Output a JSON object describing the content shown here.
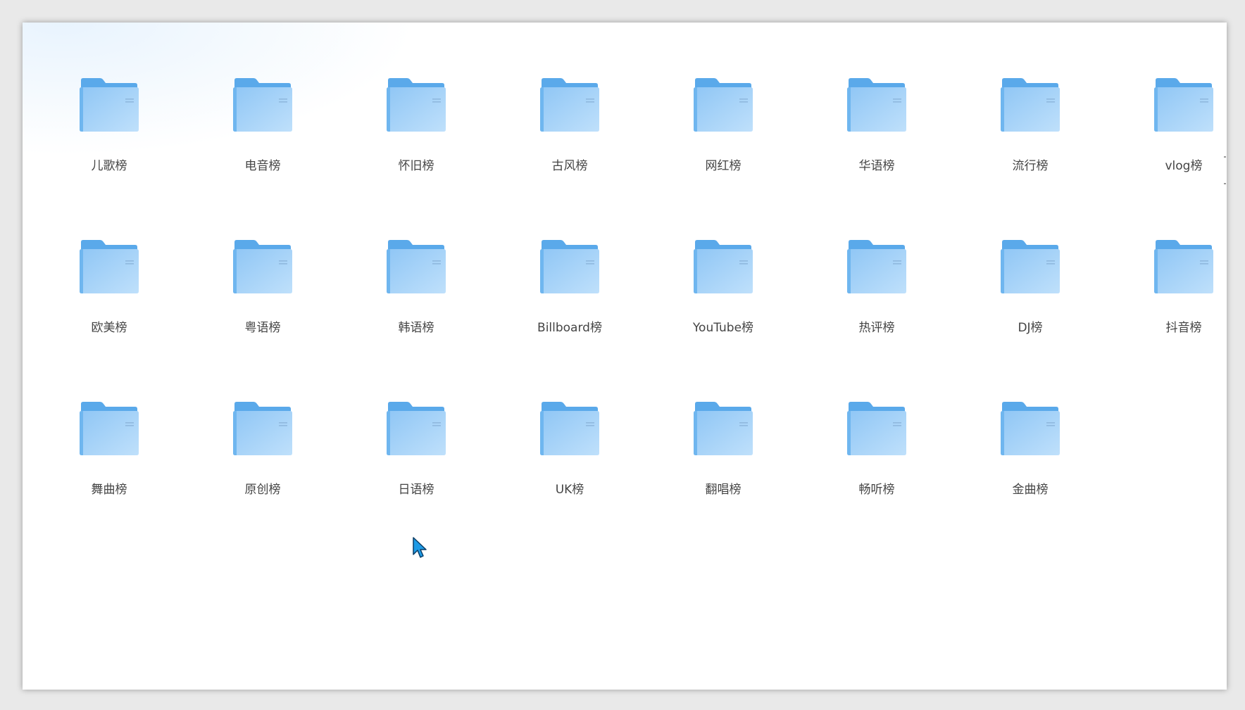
{
  "folders": [
    {
      "name": "儿歌榜"
    },
    {
      "name": "电音榜"
    },
    {
      "name": "怀旧榜"
    },
    {
      "name": "古风榜"
    },
    {
      "name": "网红榜"
    },
    {
      "name": "华语榜"
    },
    {
      "name": "流行榜"
    },
    {
      "name": "vlog榜"
    },
    {
      "name": "欧美榜"
    },
    {
      "name": "粤语榜"
    },
    {
      "name": "韩语榜"
    },
    {
      "name": "Billboard榜"
    },
    {
      "name": "YouTube榜"
    },
    {
      "name": "热评榜"
    },
    {
      "name": "DJ榜"
    },
    {
      "name": "抖音榜"
    },
    {
      "name": "舞曲榜"
    },
    {
      "name": "原创榜"
    },
    {
      "name": "日语榜"
    },
    {
      "name": "UK榜"
    },
    {
      "name": "翻唱榜"
    },
    {
      "name": "畅听榜"
    },
    {
      "name": "金曲榜"
    }
  ],
  "colors": {
    "folder_back": "#5aa9ea",
    "folder_front_top": "#9ccdf7",
    "folder_front_bottom": "#b9dcfa",
    "label": "#444444",
    "cursor": "#1e9be6"
  },
  "icons": {
    "folder": "folder-icon",
    "cursor": "mouse-cursor-icon"
  }
}
